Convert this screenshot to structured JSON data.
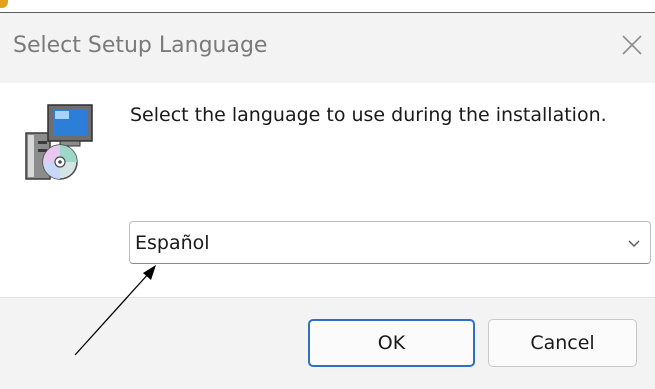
{
  "dialog": {
    "title": "Select Setup Language",
    "close_icon": "close-icon",
    "prompt": "Select the language to use during the installation.",
    "setup_icon": "setup-installer-icon",
    "language_select": {
      "value": "Español",
      "chevron_icon": "chevron-down-icon"
    },
    "buttons": {
      "ok_label": "OK",
      "cancel_label": "Cancel"
    }
  },
  "colors": {
    "accent": "#2f6fc4",
    "title_text": "#7a7a7a",
    "dialog_bg": "#f3f3f3",
    "content_bg": "#ffffff"
  }
}
